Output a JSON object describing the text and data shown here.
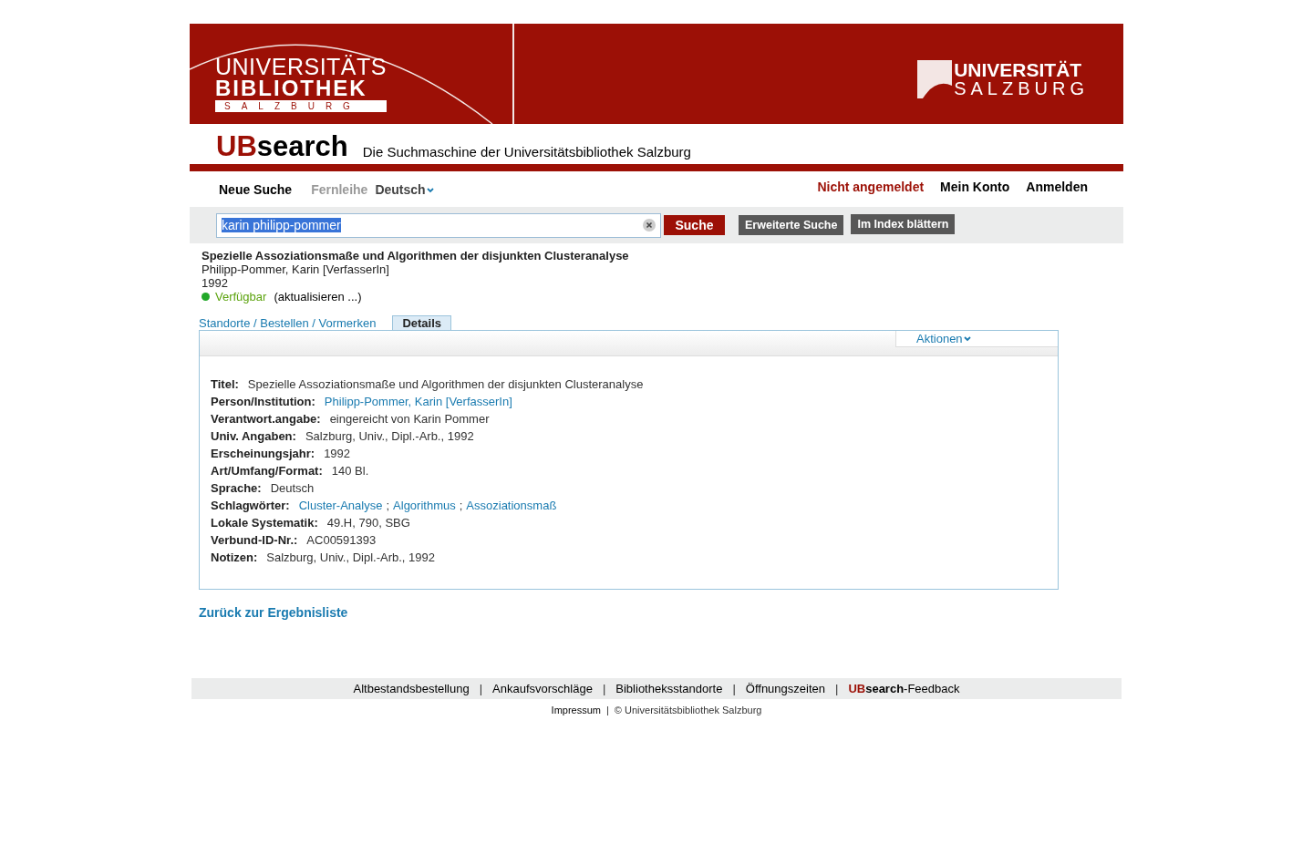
{
  "header": {
    "library_logo": [
      "UNIVERSITÄTS",
      "BIBLIOTHEK",
      "SALZBURG"
    ],
    "university_logo": [
      "UNIVERSITÄT",
      "SALZBURG"
    ]
  },
  "brand": {
    "ub": "UB",
    "search": "search",
    "tagline": "Die Suchmaschine der Universitätsbibliothek Salzburg"
  },
  "nav": {
    "left": [
      {
        "label": "Neue Suche",
        "kind": "link"
      },
      {
        "label": "Fernleihe",
        "kind": "disabled"
      },
      {
        "label": "Deutsch",
        "kind": "dropdown"
      }
    ],
    "right": [
      {
        "label": "Nicht angemeldet",
        "kind": "status"
      },
      {
        "label": "Mein Konto",
        "kind": "link"
      },
      {
        "label": "Anmelden",
        "kind": "link"
      }
    ]
  },
  "search": {
    "value": "karin philipp-pommer",
    "submit": "Suche",
    "buttons": [
      "Erweiterte Suche",
      "Im Index blättern"
    ]
  },
  "record": {
    "title": "Spezielle Assoziationsmaße und Algorithmen der disjunkten Clusteranalyse",
    "author": "Philipp-Pommer, Karin [VerfasserIn]",
    "year": "1992",
    "availability": {
      "label": "Verfügbar",
      "color": "#22a829"
    },
    "refresh": "(aktualisieren ...)"
  },
  "tabs": [
    {
      "label": "Standorte / Bestellen / Vormerken",
      "selected": false
    },
    {
      "label": "Details",
      "selected": true
    }
  ],
  "actions": "Aktionen",
  "details": [
    {
      "label": "Titel:",
      "values": [
        {
          "text": "Spezielle Assoziationsmaße und Algorithmen der disjunkten Clusteranalyse",
          "link": false
        }
      ]
    },
    {
      "label": "Person/Institution:",
      "values": [
        {
          "text": "Philipp-Pommer, Karin [VerfasserIn]",
          "link": true
        }
      ]
    },
    {
      "label": "Verantwort.angabe:",
      "values": [
        {
          "text": "eingereicht von Karin Pommer",
          "link": false
        }
      ]
    },
    {
      "label": "Univ. Angaben:",
      "values": [
        {
          "text": "Salzburg, Univ., Dipl.-Arb., 1992",
          "link": false
        }
      ]
    },
    {
      "label": "Erscheinungsjahr:",
      "values": [
        {
          "text": "1992",
          "link": false
        }
      ]
    },
    {
      "label": "Art/Umfang/Format:",
      "values": [
        {
          "text": "140 Bl.",
          "link": false
        }
      ]
    },
    {
      "label": "Sprache:",
      "values": [
        {
          "text": "Deutsch",
          "link": false
        }
      ]
    },
    {
      "label": "Schlagwörter:",
      "values": [
        {
          "text": "Cluster-Analyse",
          "link": true
        },
        {
          "text": ";",
          "link": false
        },
        {
          "text": "Algorithmus",
          "link": true
        },
        {
          "text": ";",
          "link": false
        },
        {
          "text": "Assoziationsmaß",
          "link": true
        }
      ]
    },
    {
      "label": "Lokale Systematik:",
      "values": [
        {
          "text": "49.H, 790, SBG",
          "link": false
        }
      ]
    },
    {
      "label": "Verbund-ID-Nr.:",
      "values": [
        {
          "text": "AC00591393",
          "link": false
        }
      ]
    },
    {
      "label": "Notizen:",
      "values": [
        {
          "text": "Salzburg, Univ., Dipl.-Arb., 1992",
          "link": false
        }
      ]
    }
  ],
  "back_link": "Zurück zur Ergebnisliste",
  "footer": {
    "links": [
      {
        "kind": "link",
        "text": "Altbestandsbestellung"
      },
      {
        "kind": "separator",
        "text": "|"
      },
      {
        "kind": "link",
        "text": "Ankaufsvorschläge"
      },
      {
        "kind": "separator",
        "text": "|"
      },
      {
        "kind": "link",
        "text": "Bibliotheksstandorte"
      },
      {
        "kind": "separator",
        "text": "|"
      },
      {
        "kind": "link",
        "text": "Öffnungszeiten"
      },
      {
        "kind": "separator",
        "text": "|"
      },
      {
        "kind": "feedback",
        "ub": "UB",
        "search": "search",
        "text": "-Feedback"
      }
    ],
    "imprint": "Impressum",
    "separator": "|",
    "copyright": "© Universitätsbibliothek Salzburg"
  }
}
